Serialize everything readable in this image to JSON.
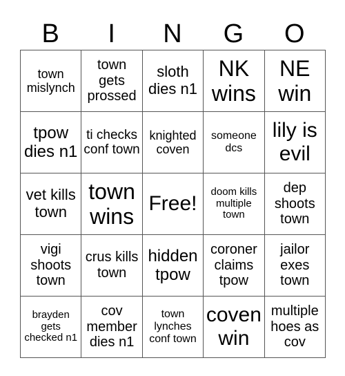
{
  "header": [
    "B",
    "I",
    "N",
    "G",
    "O"
  ],
  "cells": [
    [
      {
        "text": "town mislynch",
        "size": 18
      },
      {
        "text": "town gets prossed",
        "size": 20
      },
      {
        "text": "sloth dies n1",
        "size": 22
      },
      {
        "text": "NK wins",
        "size": 32
      },
      {
        "text": "NE win",
        "size": 32
      }
    ],
    [
      {
        "text": "tpow dies n1",
        "size": 24
      },
      {
        "text": "ti checks conf town",
        "size": 19
      },
      {
        "text": "knighted coven",
        "size": 18
      },
      {
        "text": "someone dcs",
        "size": 16
      },
      {
        "text": "lily is evil",
        "size": 30
      }
    ],
    [
      {
        "text": "vet kills town",
        "size": 22
      },
      {
        "text": "town wins",
        "size": 32
      },
      {
        "text": "Free!",
        "size": 30
      },
      {
        "text": "doom kills multiple town",
        "size": 15
      },
      {
        "text": "dep shoots town",
        "size": 20
      }
    ],
    [
      {
        "text": "vigi shoots town",
        "size": 20
      },
      {
        "text": "crus kills town",
        "size": 20
      },
      {
        "text": "hidden tpow",
        "size": 24
      },
      {
        "text": "coroner claims tpow",
        "size": 20
      },
      {
        "text": "jailor exes town",
        "size": 20
      }
    ],
    [
      {
        "text": "brayden gets checked n1",
        "size": 15
      },
      {
        "text": "cov member dies n1",
        "size": 20
      },
      {
        "text": "town lynches conf town",
        "size": 16
      },
      {
        "text": "coven win",
        "size": 30
      },
      {
        "text": "multiple hoes as cov",
        "size": 20
      }
    ]
  ]
}
